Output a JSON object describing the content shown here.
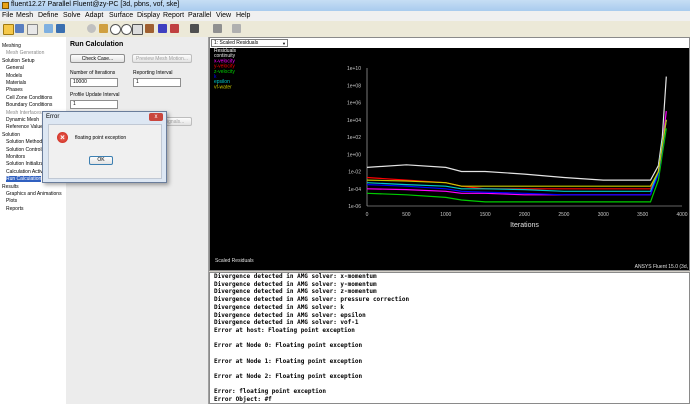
{
  "window": {
    "title": "fluent12.27 Parallel Fluent@zy-PC [3d, pbns, vof, ske]"
  },
  "menu": [
    "File",
    "Mesh",
    "Define",
    "Solve",
    "Adapt",
    "Surface",
    "Display",
    "Report",
    "Parallel",
    "View",
    "Help"
  ],
  "tree": [
    {
      "label": "Meshing",
      "indent": 0,
      "gray": false
    },
    {
      "label": "Mesh Generation",
      "indent": 1,
      "gray": true
    },
    {
      "label": "Solution Setup",
      "indent": 0,
      "gray": false
    },
    {
      "label": "General",
      "indent": 1,
      "gray": false
    },
    {
      "label": "Models",
      "indent": 1,
      "gray": false
    },
    {
      "label": "Materials",
      "indent": 1,
      "gray": false
    },
    {
      "label": "Phases",
      "indent": 1,
      "gray": false
    },
    {
      "label": "Cell Zone Conditions",
      "indent": 1,
      "gray": false
    },
    {
      "label": "Boundary Conditions",
      "indent": 1,
      "gray": false
    },
    {
      "label": "Mesh Interfaces",
      "indent": 1,
      "gray": true
    },
    {
      "label": "Dynamic Mesh",
      "indent": 1,
      "gray": false
    },
    {
      "label": "Reference Values",
      "indent": 1,
      "gray": false
    },
    {
      "label": "Solution",
      "indent": 0,
      "gray": false
    },
    {
      "label": "Solution Methods",
      "indent": 1,
      "gray": false
    },
    {
      "label": "Solution Controls",
      "indent": 1,
      "gray": false
    },
    {
      "label": "Monitors",
      "indent": 1,
      "gray": false
    },
    {
      "label": "Solution Initialization",
      "indent": 1,
      "gray": false
    },
    {
      "label": "Calculation Activities",
      "indent": 1,
      "gray": false
    },
    {
      "label": "Run Calculation",
      "indent": 1,
      "gray": false,
      "selected": true
    },
    {
      "label": "Results",
      "indent": 0,
      "gray": false
    },
    {
      "label": "Graphics and Animations",
      "indent": 1,
      "gray": false
    },
    {
      "label": "Plots",
      "indent": 1,
      "gray": false
    },
    {
      "label": "Reports",
      "indent": 1,
      "gray": false
    }
  ],
  "task": {
    "title": "Run Calculation",
    "check_case": "Check Case...",
    "preview_mesh": "Preview Mesh Motion...",
    "iterations_label": "Number of Iterations",
    "iterations_value": "10000",
    "reporting_label": "Reporting Interval",
    "reporting_value": "1",
    "profile_label": "Profile Update Interval",
    "profile_value": "1",
    "signals": "Signals..."
  },
  "graph": {
    "dropdown": "1: Scaled Residuals",
    "footer_left": "Scaled Residuals",
    "footer_right": "ANSYS Fluent 15.0 (3d,"
  },
  "dialog": {
    "title": "Error",
    "close": "x",
    "message": "floating point exception",
    "ok": "OK"
  },
  "console_lines": [
    "Divergence detected in AMG solver: x-momentum",
    "Divergence detected in AMG solver: y-momentum",
    "Divergence detected in AMG solver: z-momentum",
    "Divergence detected in AMG solver: pressure correction",
    "Divergence detected in AMG solver: k",
    "Divergence detected in AMG solver: epsilon",
    "Divergence detected in AMG solver: vof-1",
    "Error at host: Floating point exception",
    "",
    "Error at Node 0: Floating point exception",
    "",
    "Error at Node 1: Floating point exception",
    "",
    "Error at Node 2: Floating point exception",
    "",
    "Error: floating point exception",
    "Error Object: #f"
  ],
  "chart_data": {
    "type": "line",
    "title": "Scaled Residuals",
    "xlabel": "Iterations",
    "ylabel": "",
    "xlim": [
      0,
      4000
    ],
    "ylim": [
      1e-06,
      10000000000.0
    ],
    "yscale": "log",
    "xticks": [
      0,
      500,
      1000,
      1500,
      2000,
      2500,
      3000,
      3500,
      4000
    ],
    "yticks": [
      "1e-06",
      "1e-04",
      "1e-02",
      "1e+00",
      "1e+02",
      "1e+04",
      "1e+06",
      "1e+08",
      "1e+10"
    ],
    "legend": "top-left",
    "series": [
      {
        "name": "Residuals",
        "color": "#ffffff",
        "x": [],
        "y": []
      },
      {
        "name": "continuity",
        "color": "#e4e4e4",
        "x": [
          0,
          500,
          1000,
          1200,
          1500,
          2000,
          2500,
          3000,
          3600,
          3700,
          3750,
          3800
        ],
        "y": [
          0.03,
          0.06,
          0.03,
          0.01,
          0.01,
          0.005,
          0.002,
          0.001,
          0.001,
          0.05,
          100.0,
          1000000000.0
        ]
      },
      {
        "name": "x-velocity",
        "color": "#ff00ff",
        "x": [
          0,
          500,
          1000,
          1200,
          1500,
          2000,
          2500,
          3000,
          3600,
          3700,
          3750,
          3800
        ],
        "y": [
          0.0001,
          8e-05,
          5e-05,
          3e-05,
          3e-05,
          2e-05,
          2e-05,
          2e-05,
          2e-05,
          0.01,
          10,
          100000.0
        ]
      },
      {
        "name": "y-velocity",
        "color": "#ff0000",
        "x": [
          0,
          500,
          1000,
          1200,
          1500,
          2000,
          2500,
          3000,
          3600,
          3700,
          3750,
          3800
        ],
        "y": [
          0.002,
          0.001,
          0.0005,
          0.0002,
          0.0001,
          0.0001,
          0.0001,
          0.0001,
          0.0001,
          0.01,
          10,
          10000.0
        ]
      },
      {
        "name": "z-velocity",
        "color": "#00cc00",
        "x": [
          0,
          500,
          1000,
          1200,
          1500,
          2000,
          2500,
          3000,
          3600,
          3700,
          3750,
          3800
        ],
        "y": [
          3e-05,
          2e-05,
          1e-05,
          5e-06,
          3e-06,
          3e-06,
          3e-06,
          3e-06,
          3e-06,
          0.001,
          1,
          1000.0
        ]
      },
      {
        "name": "k",
        "color": "#0000ff",
        "x": [
          0,
          500,
          1000,
          1200,
          1500,
          2000,
          2500,
          3000,
          3600,
          3700,
          3750,
          3800
        ],
        "y": [
          0.0003,
          0.0002,
          0.0001,
          5e-05,
          4e-05,
          3e-05,
          2e-05,
          2e-05,
          2e-05,
          0.005,
          5,
          10000.0
        ]
      },
      {
        "name": "epsilon",
        "color": "#00c8c8",
        "x": [
          0,
          500,
          1000,
          1200,
          1500,
          2000,
          2500,
          3000,
          3600,
          3700,
          3750,
          3800
        ],
        "y": [
          0.0005,
          0.0003,
          0.0002,
          0.0001,
          0.0001,
          8e-05,
          5e-05,
          5e-05,
          5e-05,
          0.01,
          20,
          10000.0
        ]
      },
      {
        "name": "vf-water",
        "color": "#c8c800",
        "x": [
          0,
          500,
          1000,
          1200,
          1500,
          2000,
          2500,
          3000,
          3600,
          3700,
          3750,
          3800
        ],
        "y": [
          0.001,
          0.0008,
          0.0005,
          0.0002,
          0.0002,
          0.0002,
          0.0002,
          0.0002,
          0.0002,
          0.01,
          10,
          10000.0
        ]
      }
    ]
  },
  "colors": {
    "plot_bg": "#000000",
    "console_bg": "#ffffff",
    "panel_bg": "#ececec",
    "selection": "#3060c0"
  }
}
